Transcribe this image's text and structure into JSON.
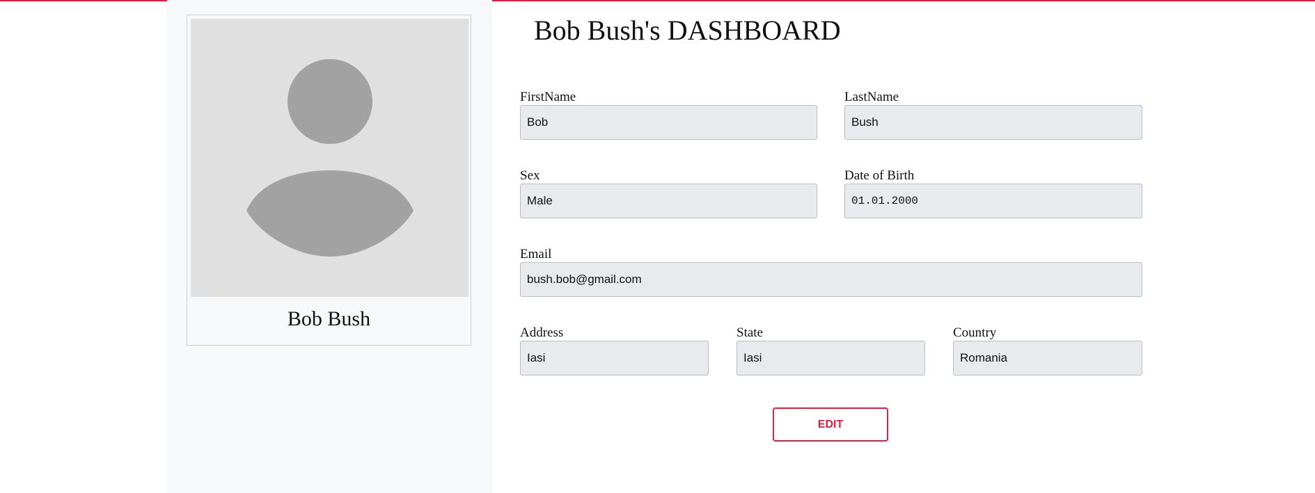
{
  "colors": {
    "accent": "#e31b3d",
    "sidebar_bg": "#f7f8fa",
    "avatar_bg": "#e0e0e0",
    "avatar_fg": "#a2a2a2",
    "input_bg": "#e8eaed"
  },
  "profile": {
    "name": "Bob Bush",
    "avatar_icon": "user-placeholder-icon"
  },
  "page": {
    "title": "Bob Bush's DASHBOARD"
  },
  "form": {
    "first_name": {
      "label": "FirstName",
      "value": "Bob"
    },
    "last_name": {
      "label": "LastName",
      "value": "Bush"
    },
    "sex": {
      "label": "Sex",
      "value": "Male"
    },
    "dob": {
      "label": "Date of Birth",
      "value": "01.01.2000"
    },
    "email": {
      "label": "Email",
      "value": "bush.bob@gmail.com"
    },
    "address": {
      "label": "Address",
      "value": "Iasi"
    },
    "state": {
      "label": "State",
      "value": "Iasi"
    },
    "country": {
      "label": "Country",
      "value": "Romania"
    }
  },
  "actions": {
    "edit_label": "EDIT"
  }
}
